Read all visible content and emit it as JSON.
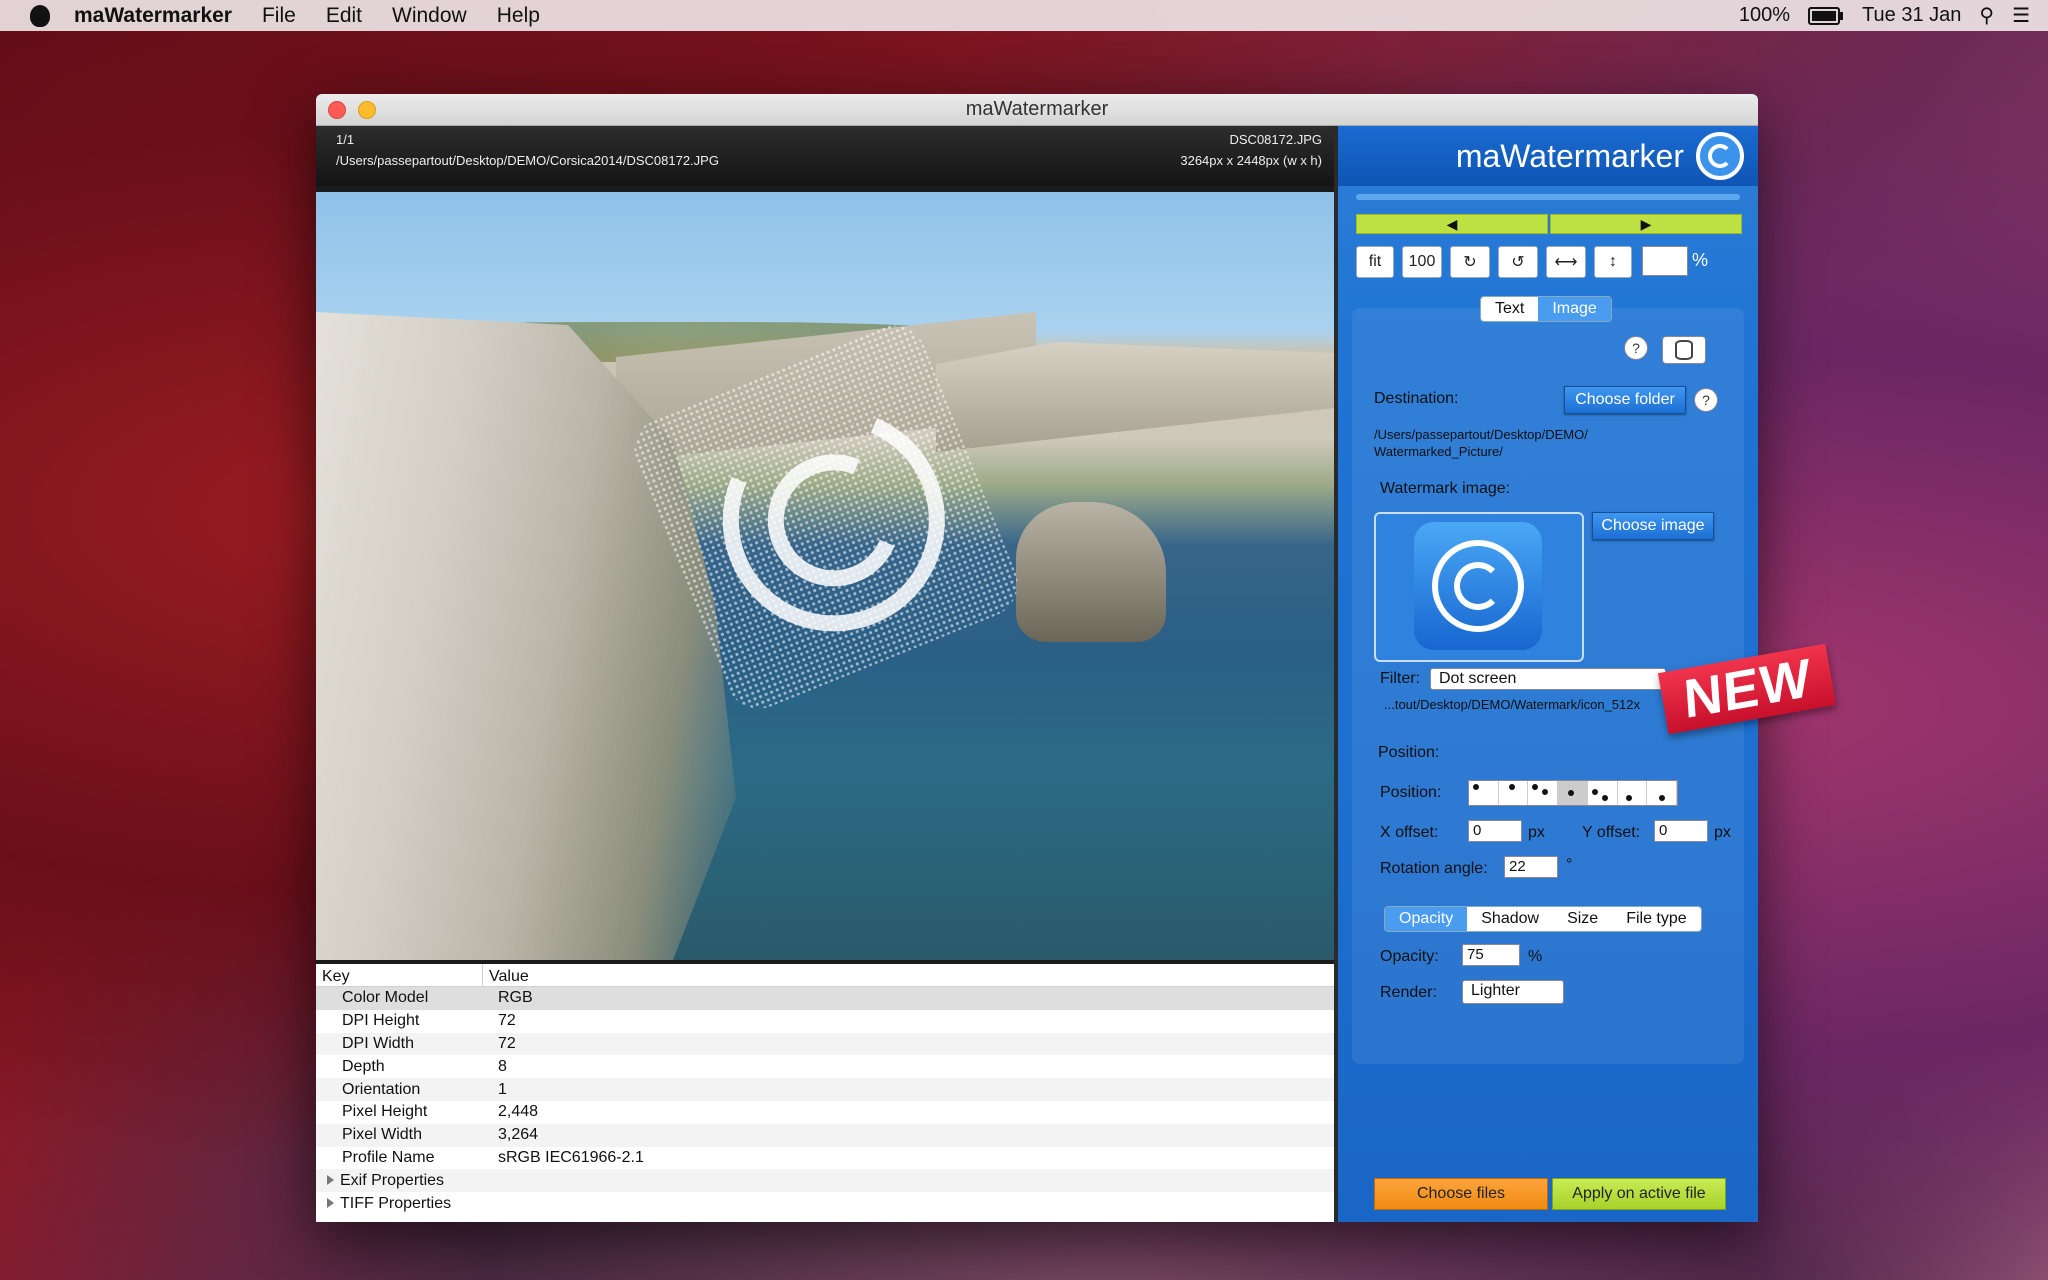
{
  "menubar": {
    "app": "maWatermarker",
    "items": [
      "File",
      "Edit",
      "Window",
      "Help"
    ],
    "battery": "100%",
    "date": "Tue 31 Jan"
  },
  "window": {
    "title": "maWatermarker"
  },
  "info": {
    "counter": "1/1",
    "path": "/Users/passepartout/Desktop/DEMO/Corsica2014/DSC08172.JPG",
    "filename": "DSC08172.JPG",
    "dimensions": "3264px x 2448px (w x h)"
  },
  "table": {
    "headers": [
      "Key",
      "Value"
    ],
    "rows": [
      {
        "key": "Color Model",
        "value": "RGB"
      },
      {
        "key": "DPI Height",
        "value": "72"
      },
      {
        "key": "DPI Width",
        "value": "72"
      },
      {
        "key": "Depth",
        "value": "8"
      },
      {
        "key": "Orientation",
        "value": "1"
      },
      {
        "key": "Pixel Height",
        "value": "2,448"
      },
      {
        "key": "Pixel Width",
        "value": "3,264"
      },
      {
        "key": "Profile Name",
        "value": "sRGB IEC61966-2.1"
      },
      {
        "key": "Exif Properties",
        "value": ""
      },
      {
        "key": "TIFF Properties",
        "value": ""
      }
    ]
  },
  "panel": {
    "brand": "maWatermarker",
    "prev": "◀",
    "next": "▶",
    "tools": {
      "fit": "fit",
      "hundred": "100",
      "rotate_cw": "↻",
      "rotate_ccw": "↺",
      "flip_h": "⟷",
      "flip_v": "↕"
    },
    "zoom_value": "",
    "zoom_unit": "%",
    "mode_tabs": [
      "Text",
      "Image"
    ],
    "help": "?",
    "destination_label": "Destination:",
    "choose_folder": "Choose folder",
    "destination_path_1": "/Users/passepartout/Desktop/DEMO/",
    "destination_path_2": "Watermarked_Picture/",
    "watermark_label": "Watermark image:",
    "choose_image": "Choose image",
    "filter_label": "Filter:",
    "filter_value": "Dot screen",
    "watermark_path": "...tout/Desktop/DEMO/Watermark/icon_512x",
    "new_badge": "NEW",
    "position_section": "Position:",
    "position_label": "Position:",
    "x_offset_label": "X offset:",
    "x_offset": "0",
    "y_offset_label": "Y offset:",
    "y_offset": "0",
    "px": "px",
    "rotation_label": "Rotation angle:",
    "rotation": "22",
    "degree": "°",
    "tabs": [
      "Opacity",
      "Shadow",
      "Size",
      "File type"
    ],
    "opacity_label": "Opacity:",
    "opacity": "75",
    "percent": "%",
    "render_label": "Render:",
    "render_value": "Lighter",
    "choose_files": "Choose files",
    "apply": "Apply on active file"
  }
}
